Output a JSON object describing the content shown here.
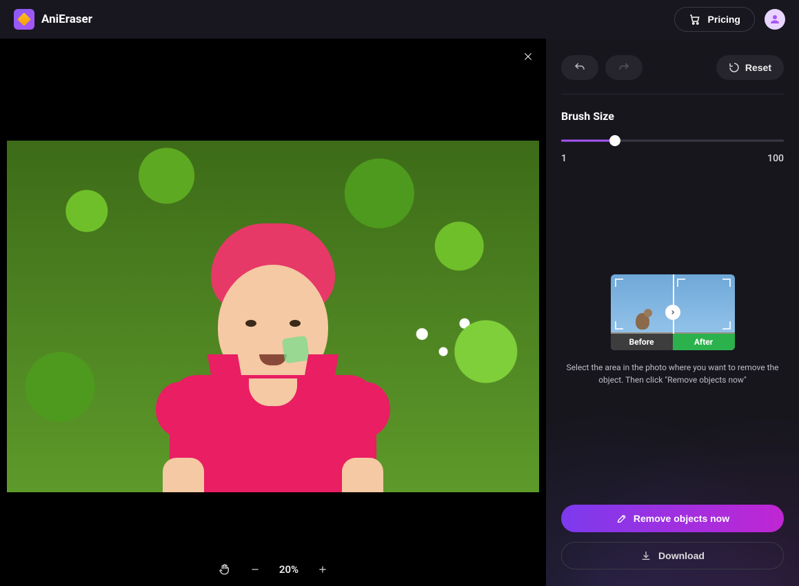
{
  "header": {
    "brand": "AniEraser",
    "pricing_label": "Pricing"
  },
  "toolbar": {
    "reset_label": "Reset"
  },
  "brush": {
    "title": "Brush Size",
    "min": "1",
    "max": "100",
    "value_pct": 24
  },
  "demo": {
    "before": "Before",
    "after": "After",
    "instruction": "Select the area in the photo where you want to remove the object. Then click \"Remove objects now\""
  },
  "actions": {
    "remove": "Remove objects now",
    "download": "Download"
  },
  "zoom": {
    "level": "20%"
  }
}
